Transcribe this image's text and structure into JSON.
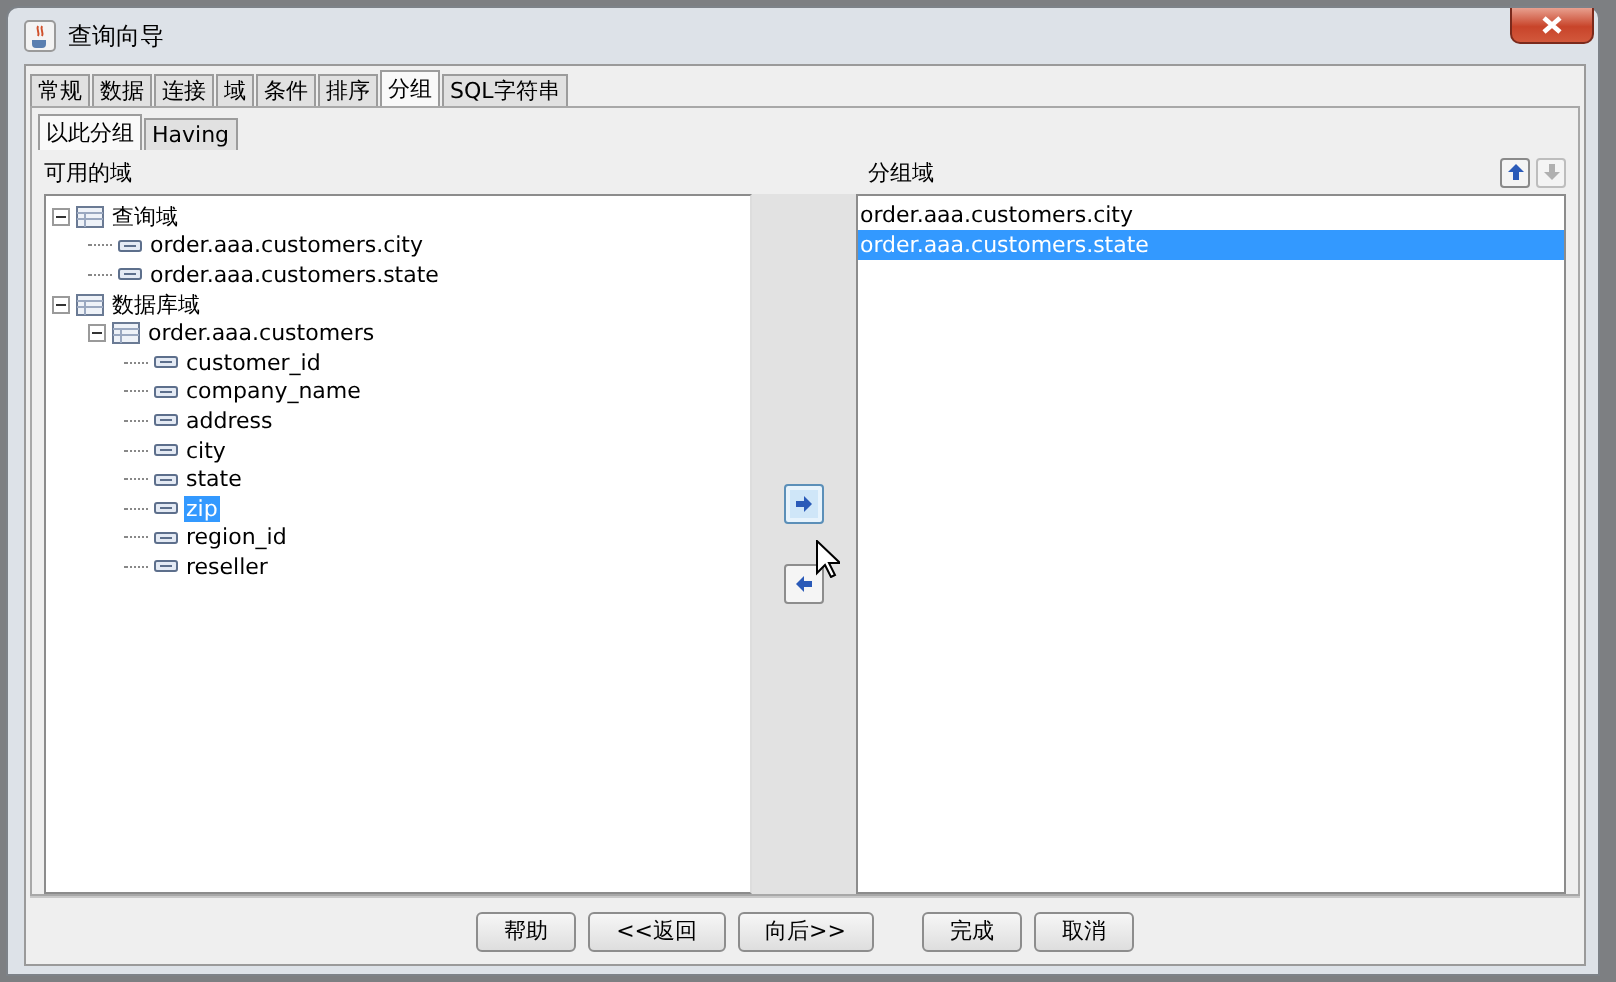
{
  "window": {
    "title": "查询向导"
  },
  "tabs": [
    {
      "label": "常规",
      "selected": false
    },
    {
      "label": "数据",
      "selected": false
    },
    {
      "label": "连接",
      "selected": false
    },
    {
      "label": "域",
      "selected": false
    },
    {
      "label": "条件",
      "selected": false
    },
    {
      "label": "排序",
      "selected": false
    },
    {
      "label": "分组",
      "selected": true
    },
    {
      "label": "SQL字符串",
      "selected": false
    }
  ],
  "subtabs": [
    {
      "label": "以此分组",
      "selected": true
    },
    {
      "label": "Having",
      "selected": false
    }
  ],
  "available": {
    "label": "可用的域",
    "tree": [
      {
        "kind": "group",
        "label": "查询域",
        "expanded": true,
        "selected": false,
        "children": [
          {
            "kind": "field",
            "label": "order.aaa.customers.city",
            "selected": false
          },
          {
            "kind": "field",
            "label": "order.aaa.customers.state",
            "selected": false
          }
        ]
      },
      {
        "kind": "group",
        "label": "数据库域",
        "expanded": true,
        "selected": false,
        "children": [
          {
            "kind": "table",
            "label": "order.aaa.customers",
            "expanded": true,
            "selected": false,
            "children": [
              {
                "kind": "field",
                "label": "customer_id",
                "selected": false
              },
              {
                "kind": "field",
                "label": "company_name",
                "selected": false
              },
              {
                "kind": "field",
                "label": "address",
                "selected": false
              },
              {
                "kind": "field",
                "label": "city",
                "selected": false
              },
              {
                "kind": "field",
                "label": "state",
                "selected": false
              },
              {
                "kind": "field",
                "label": "zip",
                "selected": true
              },
              {
                "kind": "field",
                "label": "region_id",
                "selected": false
              },
              {
                "kind": "field",
                "label": "reseller",
                "selected": false
              }
            ]
          }
        ]
      }
    ]
  },
  "move_buttons": [
    {
      "kind": "add",
      "focused": true
    },
    {
      "kind": "remove",
      "focused": false
    }
  ],
  "grouped": {
    "label": "分组域",
    "order_buttons": [
      {
        "kind": "up",
        "disabled": false
      },
      {
        "kind": "down",
        "disabled": true
      }
    ],
    "items": [
      {
        "label": "order.aaa.customers.city",
        "selected": false
      },
      {
        "label": "order.aaa.customers.state",
        "selected": true
      }
    ]
  },
  "nav_buttons": [
    {
      "label": "帮助"
    },
    {
      "label": "<<返回"
    },
    {
      "label": "向后>>"
    }
  ],
  "action_buttons": [
    {
      "label": "完成"
    },
    {
      "label": "取消"
    }
  ]
}
